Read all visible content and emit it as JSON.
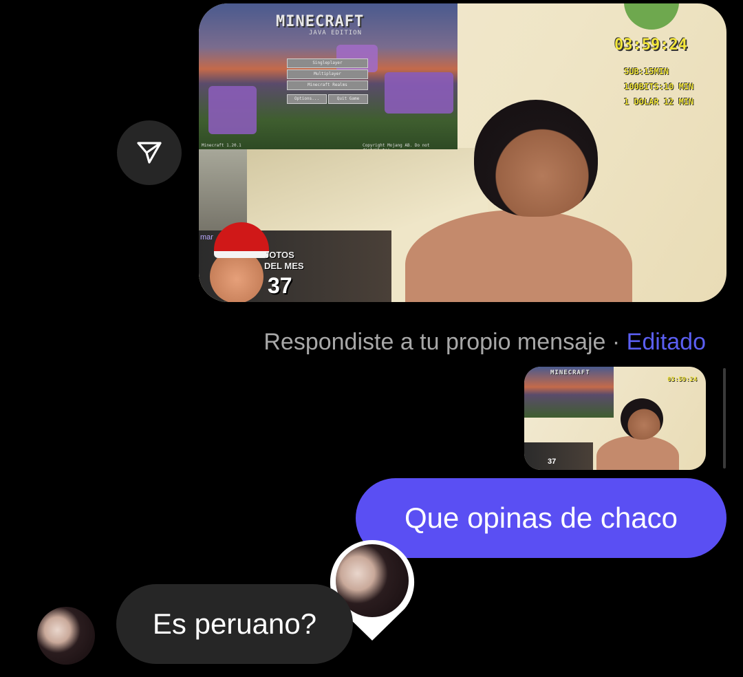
{
  "share_button": {
    "icon": "send-icon"
  },
  "shared_media": {
    "game_logo": "MINECRAFT",
    "game_edition": "JAVA EDITION",
    "menu_buttons": [
      "Singleplayer",
      "Multiplayer",
      "Minecraft Realms",
      "Options...",
      "Quit Game"
    ],
    "version_text": "Minecraft 1.20.1",
    "copyright_text": "Copyright Mojang AB. Do not distribute!",
    "timer": "03:59:24",
    "rates": [
      "SUB:15MIN",
      "100BITS:10 MIN",
      "1 DOLAR 12 MIN"
    ],
    "overlay_title": "JOTOS DEL MES",
    "overlay_count": "37",
    "overlay_tag": "mar"
  },
  "reply_meta": {
    "text": "Respondiste a tu propio mensaje",
    "separator": " · ",
    "edited": "Editado"
  },
  "quoted_media": {
    "game_logo": "MINECRAFT",
    "timer": "03:59:24",
    "overlay_count": "37"
  },
  "messages": {
    "outgoing": "Que opinas de chaco",
    "incoming": "Es peruano?"
  },
  "colors": {
    "background": "#000000",
    "outgoing_bubble": "#5a4ff3",
    "incoming_bubble": "#262626",
    "edited_link": "#5b5ff2",
    "meta_text": "#a8a8a8",
    "stream_overlay_text": "#f3e63a"
  }
}
